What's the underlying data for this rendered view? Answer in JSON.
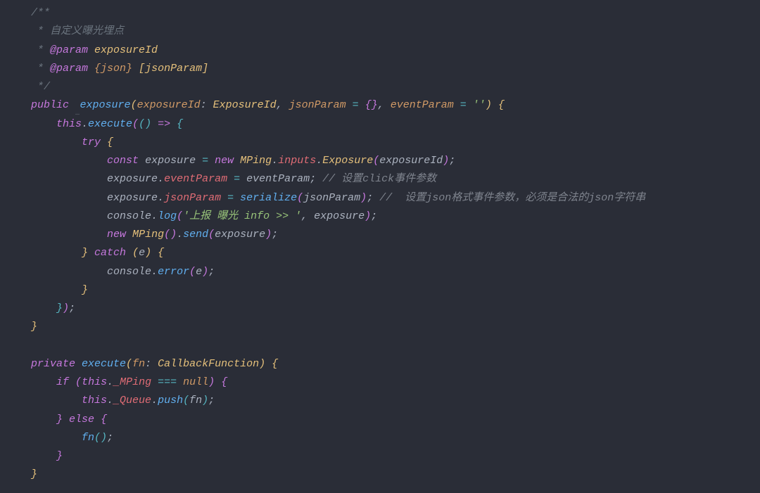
{
  "doc": {
    "l1": "/**",
    "l2_star": " * ",
    "l2_text": "自定义曝光埋点",
    "l3_star": " * ",
    "l3_tag": "@param",
    "l3_name": "exposureId",
    "l4_star": " * ",
    "l4_tag": "@param",
    "l4_type": "{json}",
    "l4_name": "[jsonParam]",
    "l5": " */"
  },
  "sig": {
    "public": "public",
    "hint": "…",
    "name": "exposure",
    "p1": "exposureId",
    "p1_type": "ExposureId",
    "p2": "jsonParam",
    "p2_def": "{}",
    "p3": "eventParam",
    "p3_def": "''"
  },
  "body": {
    "this1": "this",
    "execute": "execute",
    "arrow": "=>",
    "try": "try",
    "const_kw": "const",
    "exposure_var": "exposure",
    "new": "new",
    "MPing": "MPing",
    "inputs": "inputs",
    "Exposure": "Exposure",
    "exposureId_arg": "exposureId",
    "eventParam_prop": "eventParam",
    "eventParam_rhs": "eventParam",
    "comment1": "// 设置click事件参数",
    "jsonParam_prop": "jsonParam",
    "serialize": "serialize",
    "jsonParam_arg": "jsonParam",
    "comment2": "//  设置json格式事件参数，必须是合法的json字符串",
    "console": "console",
    "log": "log",
    "log_str": "'上报 曝光 info >> '",
    "exposure_arg": "exposure",
    "send": "send",
    "catch": "catch",
    "e": "e",
    "error": "error",
    "e_arg": "e"
  },
  "exec": {
    "private": "private",
    "name": "execute",
    "fn_param": "fn",
    "fn_type": "CallbackFunction",
    "if": "if",
    "this": "this",
    "_MPing": "_MPing",
    "eqeqeq": "===",
    "null": "null",
    "_Queue": "_Queue",
    "push": "push",
    "fn_arg": "fn",
    "else": "else",
    "fn_call": "fn"
  }
}
